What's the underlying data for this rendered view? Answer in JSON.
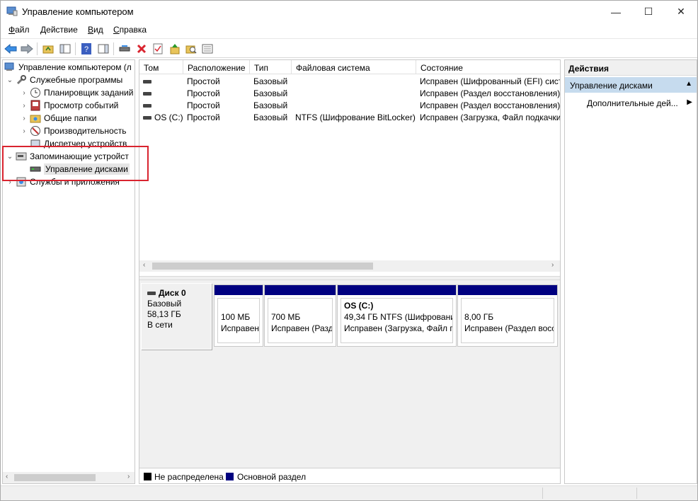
{
  "window": {
    "title": "Управление компьютером",
    "controls": {
      "minimize": "—",
      "maximize": "☐",
      "close": "✕"
    }
  },
  "menu": {
    "items": [
      {
        "first": "Ф",
        "rest": "айл"
      },
      {
        "first": "Д",
        "rest": "ействие"
      },
      {
        "first": "В",
        "rest": "ид"
      },
      {
        "first": "С",
        "rest": "правка"
      }
    ]
  },
  "tree": {
    "items": [
      {
        "label": "Управление компьютером (л",
        "icon": "computer-management-icon"
      },
      {
        "label": "Служебные программы",
        "icon": "tools-icon"
      },
      {
        "label": "Планировщик заданий",
        "icon": "clock-icon"
      },
      {
        "label": "Просмотр событий",
        "icon": "event-viewer-icon"
      },
      {
        "label": "Общие папки",
        "icon": "shared-folder-icon"
      },
      {
        "label": "Производительность",
        "icon": "performance-icon"
      },
      {
        "label": "Диспетчер устройств",
        "icon": "device-manager-icon"
      },
      {
        "label": "Запоминающие устройст",
        "icon": "storage-icon"
      },
      {
        "label": "Управление дисками",
        "icon": "disk-management-icon"
      },
      {
        "label": "Службы и приложения",
        "icon": "services-icon"
      }
    ]
  },
  "volumes": {
    "columns": [
      "Том",
      "Расположение",
      "Тип",
      "Файловая система",
      "Состояние"
    ],
    "rows": [
      {
        "tom": "",
        "loc": "Простой",
        "type": "Базовый",
        "fs": "",
        "state": "Исправен (Шифрованный (EFI) сист"
      },
      {
        "tom": "",
        "loc": "Простой",
        "type": "Базовый",
        "fs": "",
        "state": "Исправен (Раздел восстановления)"
      },
      {
        "tom": "",
        "loc": "Простой",
        "type": "Базовый",
        "fs": "",
        "state": "Исправен (Раздел восстановления)"
      },
      {
        "tom": "OS (C:)",
        "loc": "Простой",
        "type": "Базовый",
        "fs": "NTFS (Шифрование BitLocker)",
        "state": "Исправен (Загрузка, Файл подкачки"
      }
    ]
  },
  "disk": {
    "name": "Диск 0",
    "type": "Базовый",
    "size": "58,13 ГБ",
    "status": "В сети",
    "partitions": [
      {
        "name": "",
        "line1": "100 МБ",
        "line2": "Исправен"
      },
      {
        "name": "",
        "line1": "700 МБ",
        "line2": "Исправен (Разд"
      },
      {
        "name": "OS  (C:)",
        "line1": "49,34 ГБ NTFS (Шифрование",
        "line2": "Исправен (Загрузка, Файл п"
      },
      {
        "name": "",
        "line1": "8,00 ГБ",
        "line2": "Исправен (Раздел восс"
      }
    ]
  },
  "legend": {
    "unallocated": "Не распределена",
    "primary": "Основной раздел",
    "unallocated_color": "#000000",
    "primary_color": "#000080"
  },
  "actions": {
    "title": "Действия",
    "section": "Управление дисками",
    "item": "Дополнительные дей..."
  },
  "colors": {
    "partition_bar": "#000080",
    "highlight": "#d9242f",
    "actions_section_bg": "#c6dbee"
  }
}
